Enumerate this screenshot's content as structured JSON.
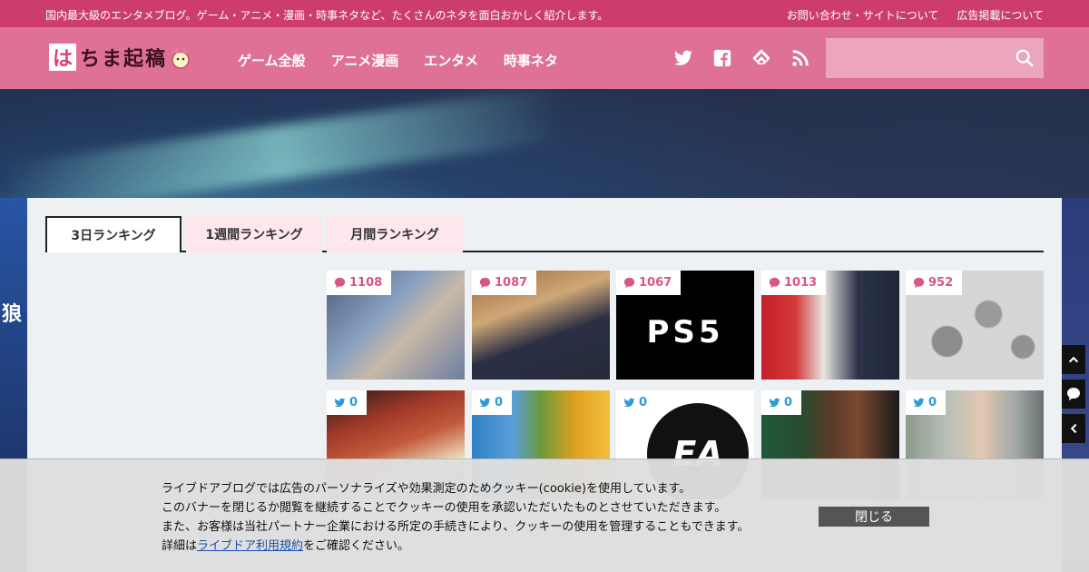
{
  "topbar": {
    "tagline": "国内最大級のエンタメブログ。ゲーム・アニメ・漫画・時事ネタなど、たくさんのネタを面白おかしく紹介します。",
    "links": [
      "お問い合わせ・サイトについて",
      "広告掲載について"
    ]
  },
  "header": {
    "logo_mark": "は",
    "logo_rest": "ちま起稿",
    "nav": [
      "ゲーム全般",
      "アニメ漫画",
      "エンタメ",
      "時事ネタ"
    ],
    "social_icons": [
      "twitter-icon",
      "facebook-icon",
      "feedly-icon",
      "rss-icon"
    ],
    "search_placeholder": ""
  },
  "hero": {
    "side_label": "狼"
  },
  "tabs": [
    "3日ランキング",
    "1週間ランキング",
    "月間ランキング"
  ],
  "active_tab": 0,
  "ranking_cards": [
    {
      "count": "1108",
      "icon": "comment-icon"
    },
    {
      "count": "1087",
      "icon": "comment-icon"
    },
    {
      "count": "1067",
      "icon": "comment-icon"
    },
    {
      "count": "1013",
      "icon": "comment-icon"
    },
    {
      "count": "952",
      "icon": "comment-icon"
    },
    {
      "count": "0",
      "icon": "twitter-icon"
    },
    {
      "count": "0",
      "icon": "twitter-icon"
    },
    {
      "count": "0",
      "icon": "twitter-icon"
    },
    {
      "count": "0",
      "icon": "twitter-icon"
    },
    {
      "count": "0",
      "icon": "twitter-icon"
    }
  ],
  "card3_logo": "PS5",
  "card8_logo": "EA",
  "colors": {
    "accent": "#df7197",
    "topbar": "#cc3d6e",
    "comment": "#d95585",
    "twitter": "#2f9bd6"
  },
  "cookie": {
    "line1": "ライブドアブログでは広告のパーソナライズや効果測定のためクッキー(cookie)を使用しています。",
    "line2": "このバナーを閉じるか閲覧を継続することでクッキーの使用を承認いただいたものとさせていただきます。",
    "line3": "また、お客様は当社パートナー企業における所定の手続きにより、クッキーの使用を管理することもできます。",
    "line4_prefix": "詳細は",
    "line4_link": "ライブドア利用規約",
    "line4_suffix": "をご確認ください。",
    "close_label": "閉じる"
  }
}
